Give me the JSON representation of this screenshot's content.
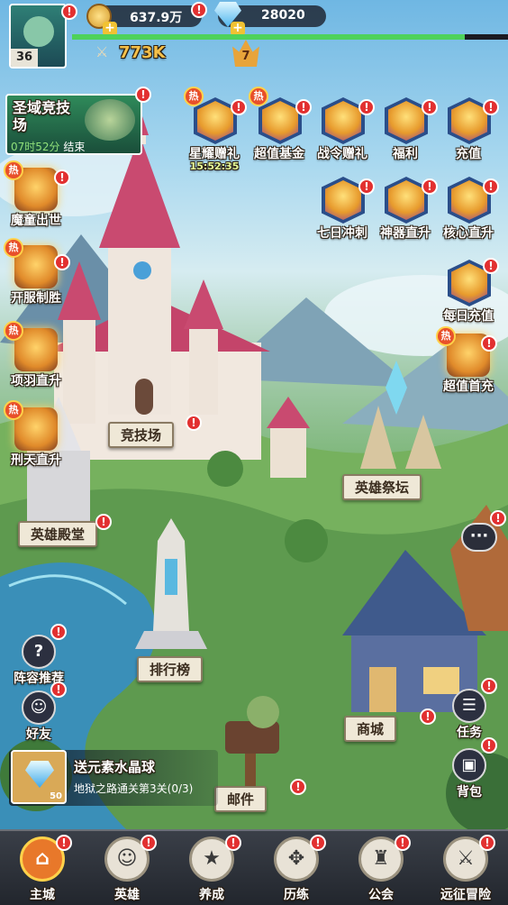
{
  "player": {
    "level": "36",
    "power": "773K",
    "vip": "7"
  },
  "currency": {
    "gold": "637.9万",
    "diamond": "28020"
  },
  "arena_event": {
    "title": "圣域竞技场",
    "countdown": "07时52分",
    "suffix": "结束"
  },
  "top_events": [
    {
      "label": "星耀赠礼",
      "timer": "15:52:35",
      "hot": "热"
    },
    {
      "label": "超值基金",
      "hot": "热"
    },
    {
      "label": "战令赠礼"
    },
    {
      "label": "福利"
    },
    {
      "label": "充值"
    },
    {
      "label": "七日冲刺"
    },
    {
      "label": "神器直升"
    },
    {
      "label": "核心直升"
    },
    {
      "label": "每日充值"
    },
    {
      "label": "超值首充",
      "hot": "热"
    }
  ],
  "left_events": [
    {
      "label": "魔童出世",
      "hot": "热"
    },
    {
      "label": "开服制胜",
      "hot": "热"
    },
    {
      "label": "项羽直升",
      "hot": "热"
    },
    {
      "label": "刑天直升",
      "hot": "热"
    }
  ],
  "buildings": {
    "arena": "竞技场",
    "hero_altar": "英雄祭坛",
    "hero_hall": "英雄殿堂",
    "ranking": "排行榜",
    "shop": "商城",
    "mail": "邮件"
  },
  "side_buttons": {
    "lineup": "阵容推荐",
    "friends": "好友",
    "tasks": "任务",
    "bag": "背包",
    "lineup_icon": "?"
  },
  "quest": {
    "title": "送元素水晶球",
    "desc": "地狱之路通关第3关(0/3)",
    "count": "50"
  },
  "tabs": [
    {
      "label": "主城",
      "glyph": "⌂"
    },
    {
      "label": "英雄",
      "glyph": "☺"
    },
    {
      "label": "养成",
      "glyph": "★"
    },
    {
      "label": "历练",
      "glyph": "✥"
    },
    {
      "label": "公会",
      "glyph": "♜"
    },
    {
      "label": "远征冒险",
      "glyph": "⚔"
    }
  ],
  "badge": "!",
  "colors": {
    "alert": "#e23030",
    "gold": "#ffd24a",
    "power": "#f5c04a",
    "exp_bar": "#4ed25a",
    "tab_active": "#e8782a"
  },
  "icons": [
    "gold-coin-icon",
    "diamond-icon",
    "plus-icon",
    "power-swords-icon",
    "vip-crown-icon",
    "chat-icon",
    "crystal-icon"
  ]
}
